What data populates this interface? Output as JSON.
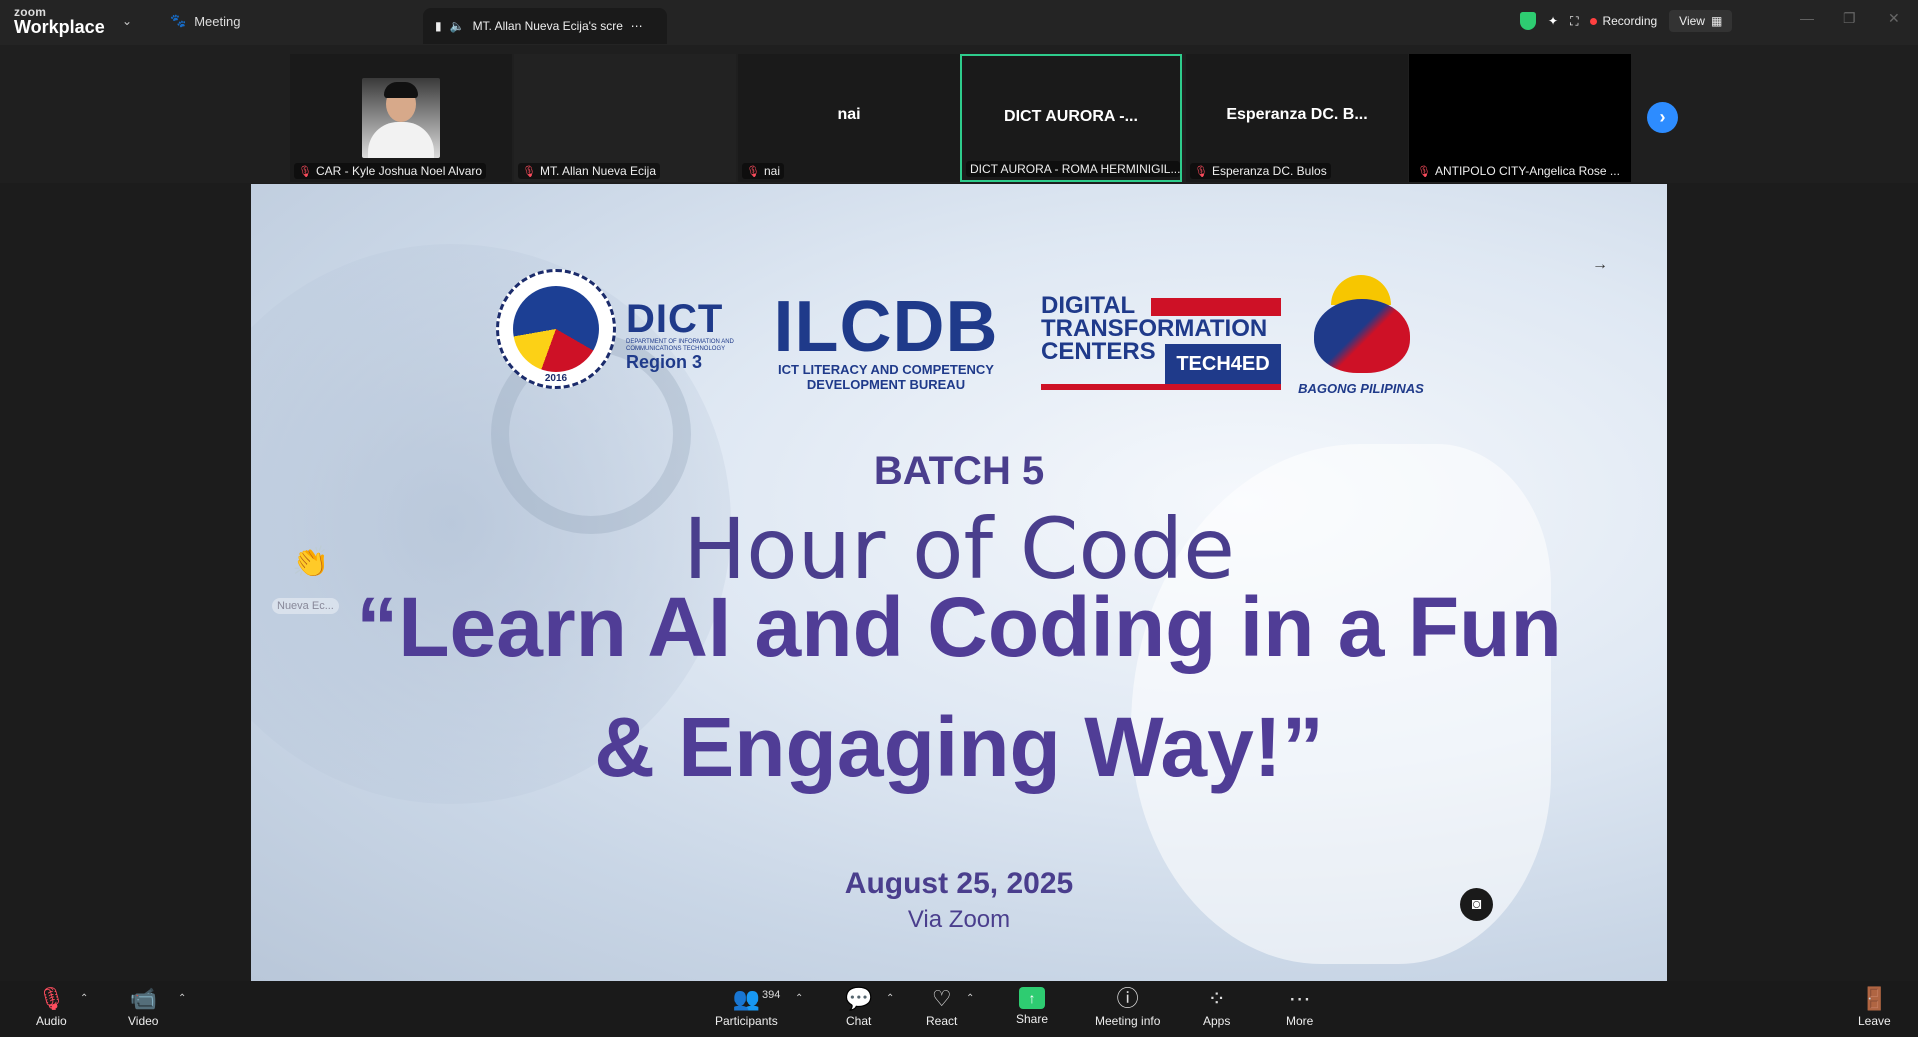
{
  "titlebar": {
    "brand_top": "zoom",
    "brand_bottom": "Workplace",
    "meeting_label": "Meeting",
    "share_tab": "MT. Allan Nueva Ecija's scree",
    "recording": "Recording",
    "view": "View"
  },
  "gallery": {
    "tiles": [
      {
        "name": "CAR - Kyle Joshua Noel Alvaro",
        "big": ""
      },
      {
        "name": "MT. Allan Nueva Ecija",
        "big": ""
      },
      {
        "name": "nai",
        "big": "nai"
      },
      {
        "name": "DICT AURORA - ROMA HERMINIGIL...",
        "big": "DICT AURORA -..."
      },
      {
        "name": "Esperanza DC. Bulos",
        "big": "Esperanza DC. B..."
      },
      {
        "name": "ANTIPOLO CITY-Angelica Rose ...",
        "big": ""
      }
    ]
  },
  "slide": {
    "dict_top": "DICT",
    "dict_sub": "DEPARTMENT OF INFORMATION AND COMMUNICATIONS TECHNOLOGY",
    "dict_region": "Region 3",
    "seal_year": "2016",
    "ilcdb": "ILCDB",
    "ilcdb_sub": "ICT LITERACY AND COMPETENCY DEVELOPMENT BUREAU",
    "dtc_1": "DIGITAL",
    "dtc_2": "TRANSFORMATION",
    "dtc_3": "CENTERS",
    "tech4ed": "TECH4ED",
    "bagong": "BAGONG PILIPINAS",
    "batch": "BATCH 5",
    "hour_of_code": "Hour of Code",
    "title_line1": "“Learn AI and Coding in a Fun",
    "title_line2": "& Engaging Way!”",
    "date": "August 25, 2025",
    "via": "Via Zoom",
    "reaction_label": "Nueva Ec..."
  },
  "toolbar": {
    "audio": "Audio",
    "video": "Video",
    "participants": "Participants",
    "participants_count": "394",
    "chat": "Chat",
    "react": "React",
    "share": "Share",
    "meeting_info": "Meeting info",
    "apps": "Apps",
    "more": "More",
    "leave": "Leave"
  },
  "colors": {
    "accent": "#2d8cff",
    "share_green": "#2ecc71",
    "active_border": "#2ecc8c",
    "muted_red": "#ff4d5e",
    "slide_purple": "#4a3e8d"
  }
}
